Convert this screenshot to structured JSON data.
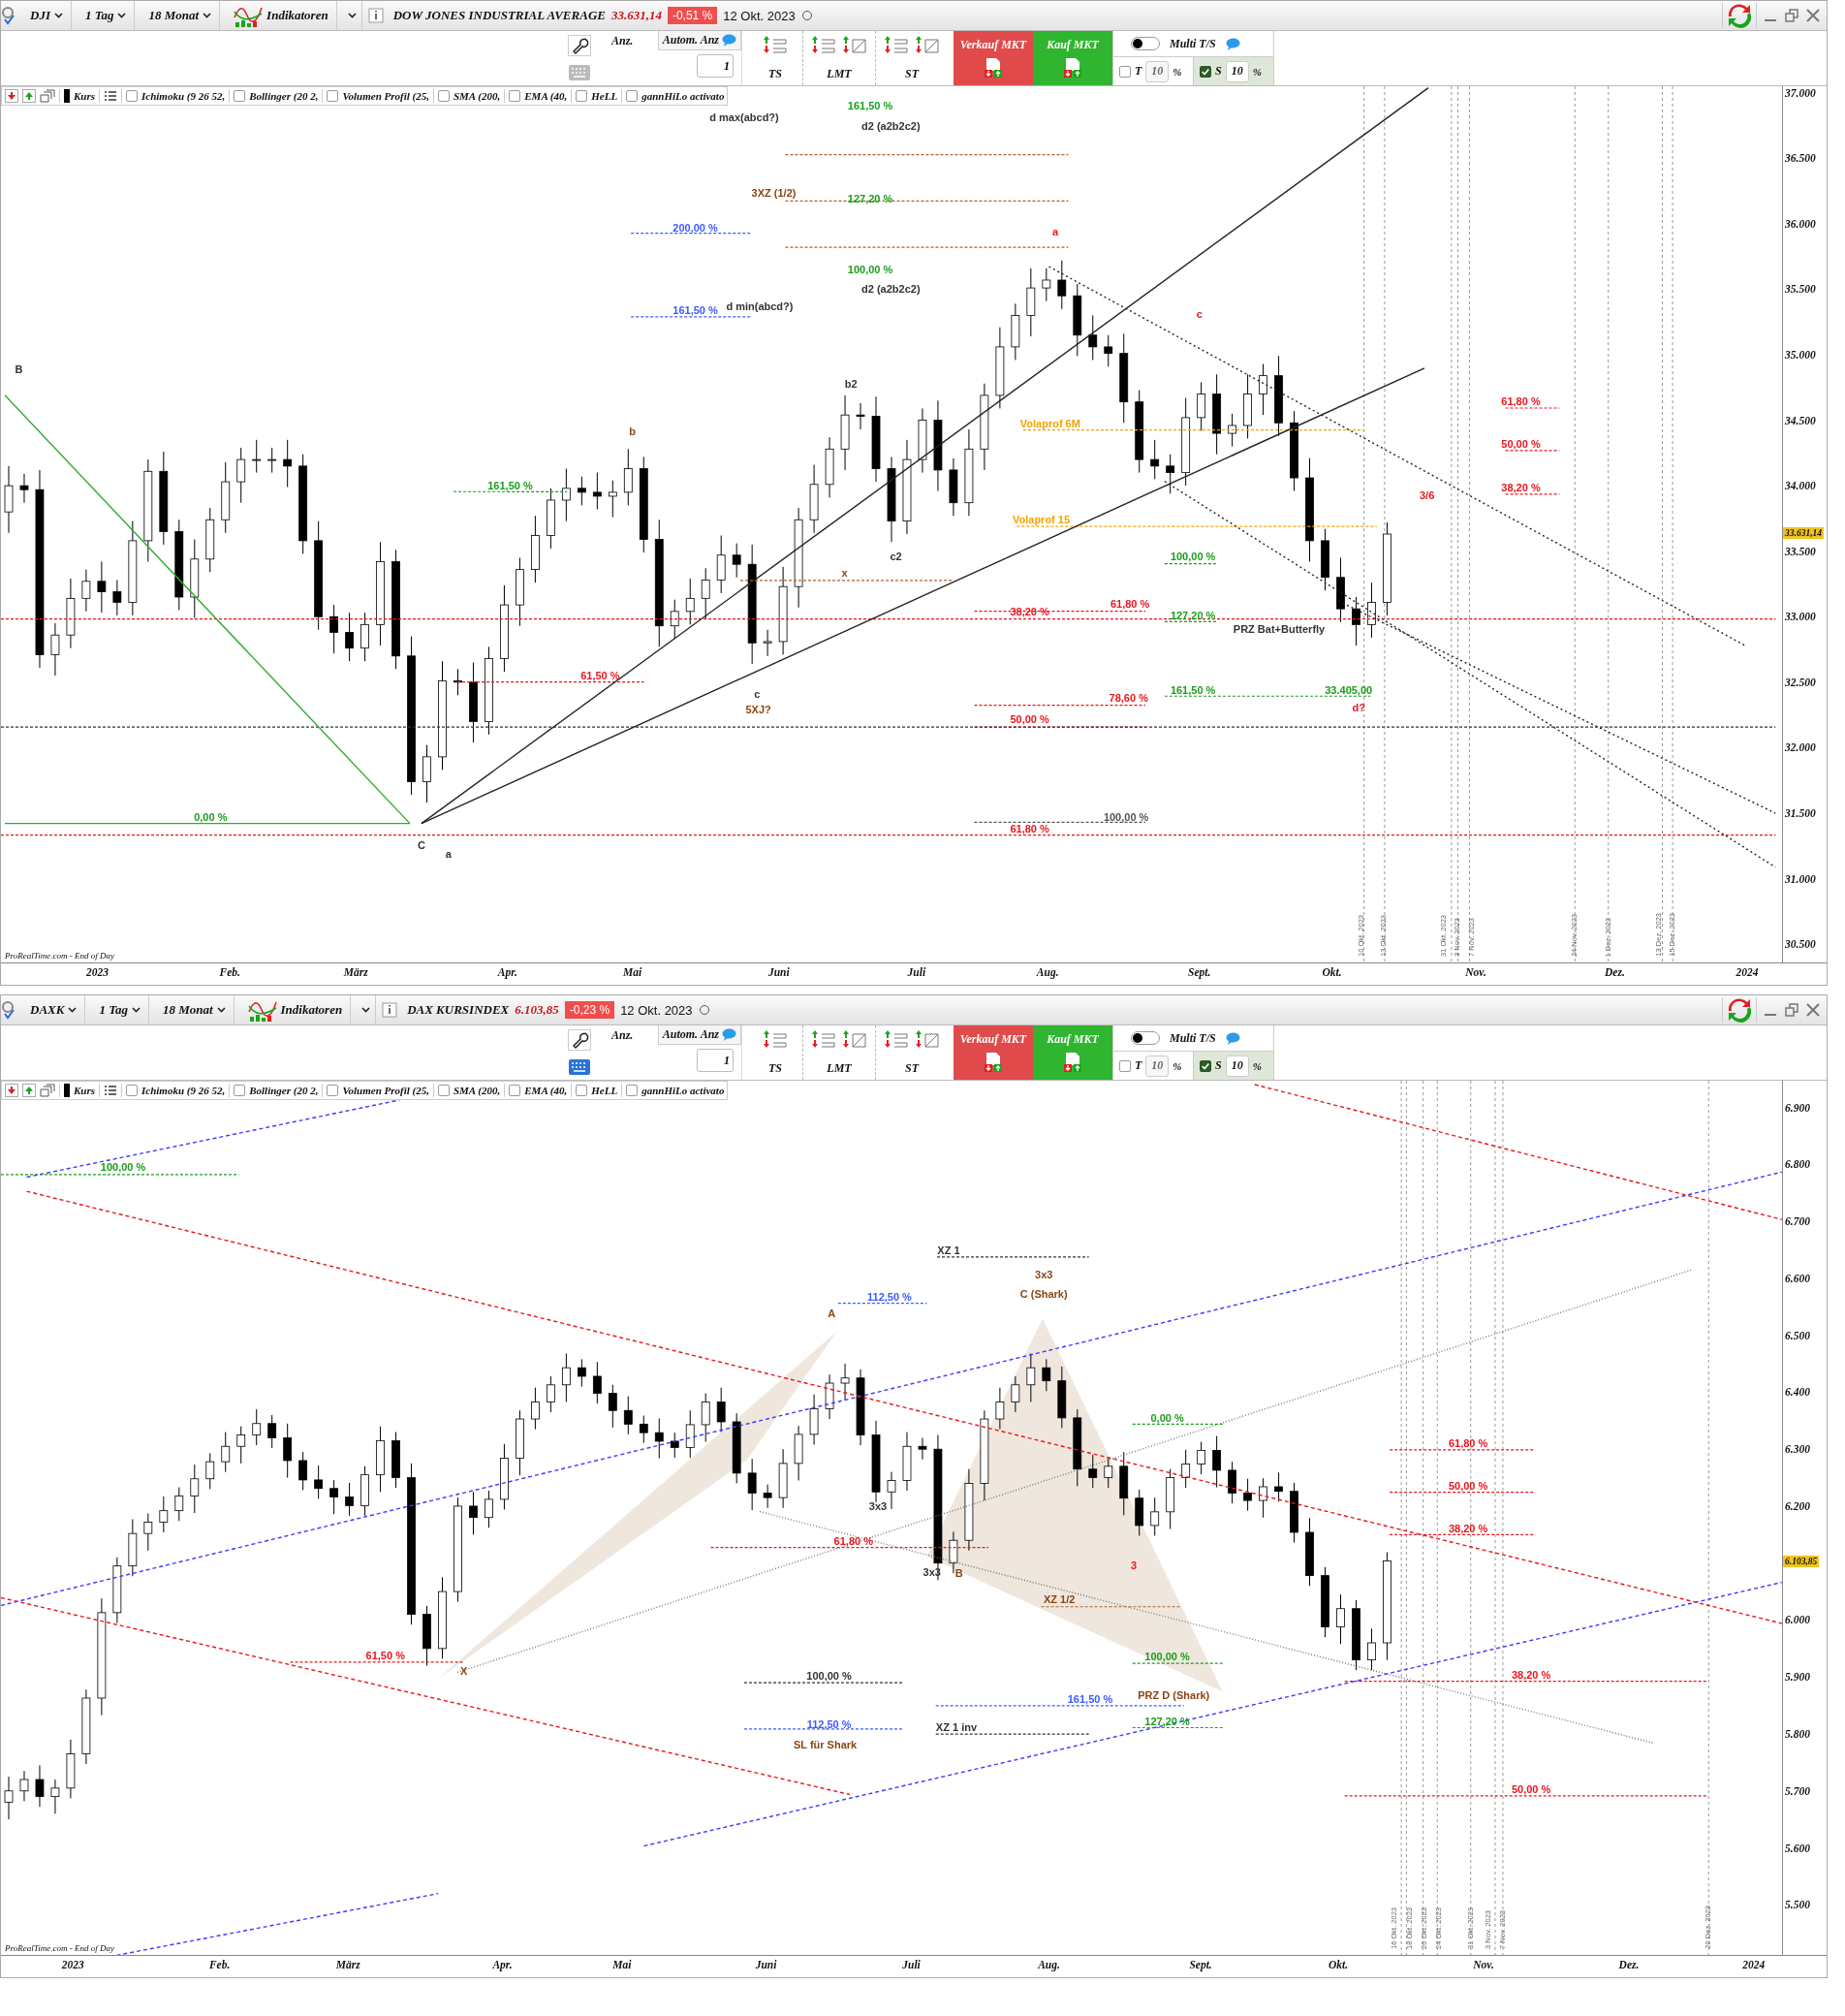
{
  "panels": [
    {
      "header": {
        "symbol": "DJI",
        "interval": "1 Tag",
        "range": "18 Monat",
        "indicators_label": "Indikatoren",
        "title": "DOW JONES INDUSTRIAL AVERAGE",
        "price": "33.631,14",
        "change": "-0,51 %",
        "date": "12 Okt. 2023"
      },
      "toolbar": {
        "keyboard_active": false,
        "count_label": "Anz.",
        "auto_tab": "Autom. Anz",
        "count_value": "1",
        "order_types": [
          "TS",
          "LMT",
          "ST"
        ],
        "sell_button": "Verkauf MKT",
        "buy_button": "Kauf MKT",
        "multi_ts": {
          "label": "Multi T/S",
          "on": false
        },
        "target": {
          "label": "T",
          "checked": false,
          "value": "10",
          "unit": "%"
        },
        "stop": {
          "label": "S",
          "checked": true,
          "value": "10",
          "unit": "%"
        }
      },
      "series_label": "Kurs",
      "indicators": [
        {
          "label": "Ichimoku (9 26 52,",
          "checked": false
        },
        {
          "label": "Bollinger (20 2,",
          "checked": false
        },
        {
          "label": "Volumen Profil (25,",
          "checked": false
        },
        {
          "label": "SMA (200,",
          "checked": false
        },
        {
          "label": "EMA (40,",
          "checked": false
        },
        {
          "label": "HeLL",
          "checked": false
        },
        {
          "label": "gannHiLo activato",
          "checked": false
        }
      ],
      "chart": {
        "price_tag": "33.631,14",
        "x_labels": [
          "2023",
          "Feb.",
          "März",
          "Apr.",
          "Mai",
          "Juni",
          "Juli",
          "Aug.",
          "Sept.",
          "Okt.",
          "Nov.",
          "Dez.",
          "2024"
        ],
        "date_markers": [
          "10 Okt. 2023",
          "13 Okt. 2023",
          "31 Okt. 2023",
          "3 Nov. 2023",
          "7 Nov. 2023",
          "24 Nov. 2023",
          "1 Dez. 2023",
          "13 Dez. 2023",
          "15 Dez. 2023"
        ],
        "source": "ProRealTime.com - End of Day",
        "chart_data": {
          "type": "candlestick",
          "categories": [
            null,
            null,
            null,
            null,
            null,
            null,
            null,
            null,
            null,
            null,
            null,
            null,
            null,
            null,
            null,
            null,
            null,
            null,
            null,
            null,
            null,
            null,
            null,
            null,
            null,
            null,
            null,
            null,
            null,
            null,
            null,
            null,
            null,
            null,
            null,
            null,
            null,
            null,
            null,
            null,
            null,
            null,
            null,
            null,
            null,
            null,
            null,
            null,
            null,
            null,
            null,
            null,
            null,
            null,
            null,
            null,
            null,
            null,
            null,
            null,
            null,
            null,
            null,
            null,
            null,
            null,
            null,
            null,
            null,
            null,
            null,
            null,
            null,
            null,
            null,
            null,
            null,
            null,
            null,
            null,
            null,
            null,
            null,
            null,
            null,
            null,
            null,
            null,
            null,
            null,
            null,
            null,
            null,
            null,
            null,
            null,
            null,
            null,
            null,
            null,
            null,
            null,
            null,
            null,
            null,
            null,
            null,
            null,
            null,
            null,
            null,
            null,
            null,
            null,
            null
          ],
          "ylim": [
            30360,
            37050
          ],
          "grid": true,
          "yticks": [
            {
              "value": 37000,
              "label": "37.000"
            },
            {
              "value": 36500,
              "label": "36.500"
            },
            {
              "value": 36000,
              "label": "36.000"
            },
            {
              "value": 35500,
              "label": "35.500"
            },
            {
              "value": 35000,
              "label": "35.000"
            },
            {
              "value": 34500,
              "label": "34.500"
            },
            {
              "value": 34000,
              "label": "34.000"
            },
            {
              "value": 33500,
              "label": "33.500"
            },
            {
              "value": 33000,
              "label": "33.000"
            },
            {
              "value": 32500,
              "label": "32.500"
            },
            {
              "value": 32000,
              "label": "32.000"
            },
            {
              "value": 31500,
              "label": "31.500"
            },
            {
              "value": 31000,
              "label": "31.000"
            },
            {
              "value": 30500,
              "label": "30.500"
            }
          ],
          "ohlc": [
            [
              33800,
              34150,
              33640,
              34000
            ],
            [
              34000,
              34090,
              33870,
              33970
            ],
            [
              33970,
              34120,
              32610,
              32710
            ],
            [
              32710,
              32950,
              32550,
              32860
            ],
            [
              32860,
              33290,
              32760,
              33140
            ],
            [
              33140,
              33360,
              33040,
              33270
            ],
            [
              33270,
              33420,
              33030,
              33190
            ],
            [
              33190,
              33280,
              33010,
              33110
            ],
            [
              33110,
              33730,
              33010,
              33580
            ],
            [
              33580,
              34200,
              33420,
              34110
            ],
            [
              34110,
              34260,
              33550,
              33650
            ],
            [
              33650,
              33740,
              33050,
              33150
            ],
            [
              33150,
              33590,
              32990,
              33440
            ],
            [
              33440,
              33830,
              33340,
              33740
            ],
            [
              33740,
              34180,
              33640,
              34030
            ],
            [
              34030,
              34290,
              33870,
              34200
            ],
            [
              34200,
              34350,
              34100,
              34200
            ],
            [
              34200,
              34290,
              34100,
              34200
            ],
            [
              34200,
              34350,
              33990,
              34150
            ],
            [
              34150,
              34240,
              33480,
              33580
            ],
            [
              33580,
              33730,
              32900,
              33000
            ],
            [
              33000,
              33090,
              32720,
              32880
            ],
            [
              32880,
              33030,
              32660,
              32760
            ],
            [
              32760,
              33030,
              32660,
              32940
            ],
            [
              32940,
              33570,
              32780,
              33420
            ],
            [
              33420,
              33510,
              32600,
              32700
            ],
            [
              32700,
              32850,
              31640,
              31740
            ],
            [
              31740,
              32020,
              31580,
              31930
            ],
            [
              31930,
              32660,
              31830,
              32510
            ],
            [
              32510,
              32600,
              32400,
              32500
            ],
            [
              32500,
              32650,
              32040,
              32200
            ],
            [
              32200,
              32770,
              32100,
              32680
            ],
            [
              32680,
              33240,
              32580,
              33090
            ],
            [
              33090,
              33450,
              32930,
              33360
            ],
            [
              33360,
              33770,
              33260,
              33620
            ],
            [
              33620,
              33980,
              33520,
              33890
            ],
            [
              33890,
              34130,
              33730,
              33980
            ],
            [
              33980,
              34070,
              33850,
              33950
            ],
            [
              33950,
              34100,
              33820,
              33920
            ],
            [
              33920,
              34040,
              33760,
              33950
            ],
            [
              33950,
              34280,
              33850,
              34130
            ],
            [
              34130,
              34220,
              33490,
              33590
            ],
            [
              33590,
              33740,
              32770,
              32930
            ],
            [
              32930,
              33130,
              32830,
              33040
            ],
            [
              33040,
              33290,
              32940,
              33140
            ],
            [
              33140,
              33370,
              32980,
              33280
            ],
            [
              33280,
              33620,
              33180,
              33470
            ],
            [
              33470,
              33560,
              33300,
              33400
            ],
            [
              33400,
              33550,
              32640,
              32800
            ],
            [
              32800,
              32900,
              32700,
              32810
            ],
            [
              32810,
              33380,
              32710,
              33230
            ],
            [
              33230,
              33830,
              33070,
              33740
            ],
            [
              33740,
              34160,
              33640,
              34010
            ],
            [
              34010,
              34370,
              33910,
              34280
            ],
            [
              34280,
              34690,
              34120,
              34540
            ],
            [
              34540,
              34630,
              34430,
              34530
            ],
            [
              34530,
              34680,
              34030,
              34130
            ],
            [
              34130,
              34220,
              33570,
              33730
            ],
            [
              33730,
              34350,
              33630,
              34200
            ],
            [
              34200,
              34590,
              34100,
              34500
            ],
            [
              34500,
              34650,
              33960,
              34120
            ],
            [
              34120,
              34210,
              33770,
              33870
            ],
            [
              33870,
              34430,
              33770,
              34280
            ],
            [
              34280,
              34780,
              34120,
              34690
            ],
            [
              34690,
              35210,
              34590,
              35060
            ],
            [
              35060,
              35390,
              34960,
              35300
            ],
            [
              35300,
              35660,
              35140,
              35510
            ],
            [
              35510,
              35660,
              35410,
              35570
            ],
            [
              35570,
              35720,
              35350,
              35450
            ],
            [
              35450,
              35540,
              34990,
              35150
            ],
            [
              35150,
              35300,
              34960,
              35060
            ],
            [
              35060,
              35150,
              34910,
              35010
            ],
            [
              35010,
              35160,
              34480,
              34640
            ],
            [
              34640,
              34730,
              34100,
              34200
            ],
            [
              34200,
              34350,
              34050,
              34150
            ],
            [
              34150,
              34240,
              33940,
              34100
            ],
            [
              34100,
              34670,
              34000,
              34520
            ],
            [
              34520,
              34790,
              34420,
              34700
            ],
            [
              34700,
              34850,
              34240,
              34400
            ],
            [
              34400,
              34550,
              34300,
              34460
            ],
            [
              34460,
              34850,
              34360,
              34700
            ],
            [
              34700,
              34930,
              34540,
              34840
            ],
            [
              34840,
              34990,
              34380,
              34480
            ],
            [
              34480,
              34570,
              33960,
              34060
            ],
            [
              34060,
              34210,
              33420,
              33580
            ],
            [
              33580,
              33670,
              33200,
              33300
            ],
            [
              33300,
              33450,
              32960,
              33060
            ],
            [
              33060,
              33150,
              32780,
              32940
            ],
            [
              32940,
              33260,
              32840,
              33110
            ],
            [
              33110,
              33720,
              33010,
              33631
            ],
            null,
            null,
            null,
            null,
            null,
            null,
            null,
            null,
            null,
            null,
            null,
            null,
            null,
            null,
            null,
            null,
            null,
            null,
            null,
            null,
            null,
            null,
            null,
            null,
            null
          ]
        },
        "annotations": [
          {
            "text": "161,50 %",
            "color": "#1a9e1a"
          },
          {
            "text": "d max(abcd?)",
            "color": "#333333"
          },
          {
            "text": "d2 (a2b2c2)",
            "color": "#333333"
          },
          {
            "text": "3XZ (1/2)",
            "color": "#8b4513"
          },
          {
            "text": "127,20 %",
            "color": "#1a9e1a"
          },
          {
            "text": "200,00 %",
            "color": "#3b5bff"
          },
          {
            "text": "a",
            "color": "#e8161c"
          },
          {
            "text": "100,00 %",
            "color": "#1a9e1a"
          },
          {
            "text": "d2 (a2b2c2)",
            "color": "#333333"
          },
          {
            "text": "161,50 %",
            "color": "#3b5bff"
          },
          {
            "text": "d min(abcd?)",
            "color": "#333333"
          },
          {
            "text": "c",
            "color": "#e8161c"
          },
          {
            "text": "B",
            "color": "#333333"
          },
          {
            "text": "b2",
            "color": "#333333"
          },
          {
            "text": "61,80 %",
            "color": "#e8161c"
          },
          {
            "text": "b",
            "color": "#8b4513"
          },
          {
            "text": "Volaprof 6M",
            "color": "#f5a300"
          },
          {
            "text": "50,00 %",
            "color": "#e8161c"
          },
          {
            "text": "161,50 %",
            "color": "#1a9e1a"
          },
          {
            "text": "38,20 %",
            "color": "#e8161c"
          },
          {
            "text": "3/6",
            "color": "#e8161c"
          },
          {
            "text": "Volaprof 15",
            "color": "#f5a300"
          },
          {
            "text": "c2",
            "color": "#333333"
          },
          {
            "text": "100,00 %",
            "color": "#1a9e1a"
          },
          {
            "text": "x",
            "color": "#8b4513"
          },
          {
            "text": "38,20 %",
            "color": "#e8161c"
          },
          {
            "text": "61,80 %",
            "color": "#e8161c"
          },
          {
            "text": "127,20 %",
            "color": "#1a9e1a"
          },
          {
            "text": "PRZ Bat+Butterfly",
            "color": "#333333"
          },
          {
            "text": "61,50 %",
            "color": "#e8161c"
          },
          {
            "text": "c",
            "color": "#333333"
          },
          {
            "text": "78,60 %",
            "color": "#e8161c"
          },
          {
            "text": "161,50 %",
            "color": "#1a9e1a"
          },
          {
            "text": "33.405,00",
            "color": "#1a9e1a"
          },
          {
            "text": "5XJ?",
            "color": "#8b4513"
          },
          {
            "text": "d?",
            "color": "#e8161c"
          },
          {
            "text": "50,00 %",
            "color": "#e8161c"
          },
          {
            "text": "0,00 %",
            "color": "#1a9e1a"
          },
          {
            "text": "100,00 %",
            "color": "#555555"
          },
          {
            "text": "61,80 %",
            "color": "#e8161c"
          },
          {
            "text": "C",
            "color": "#333333"
          },
          {
            "text": "a",
            "color": "#333333"
          }
        ]
      }
    },
    {
      "header": {
        "symbol": "DAXK",
        "interval": "1 Tag",
        "range": "18 Monat",
        "indicators_label": "Indikatoren",
        "title": "DAX KURSINDEX",
        "price": "6.103,85",
        "change": "-0,23 %",
        "date": "12 Okt. 2023"
      },
      "toolbar": {
        "keyboard_active": true,
        "count_label": "Anz.",
        "auto_tab": "Autom. Anz",
        "count_value": "1",
        "order_types": [
          "TS",
          "LMT",
          "ST"
        ],
        "sell_button": "Verkauf MKT",
        "buy_button": "Kauf MKT",
        "multi_ts": {
          "label": "Multi T/S",
          "on": false
        },
        "target": {
          "label": "T",
          "checked": false,
          "value": "10",
          "unit": "%"
        },
        "stop": {
          "label": "S",
          "checked": true,
          "value": "10",
          "unit": "%"
        }
      },
      "series_label": "Kurs",
      "indicators": [
        {
          "label": "Ichimoku (9 26 52,",
          "checked": false
        },
        {
          "label": "Bollinger (20 2,",
          "checked": false
        },
        {
          "label": "Volumen Profil (25,",
          "checked": false
        },
        {
          "label": "SMA (200,",
          "checked": false
        },
        {
          "label": "EMA (40,",
          "checked": false
        },
        {
          "label": "HeLL",
          "checked": false
        },
        {
          "label": "gannHiLo activato",
          "checked": false
        }
      ],
      "chart": {
        "price_tag": "6.103,85",
        "x_labels": [
          "2023",
          "Feb.",
          "März",
          "Apr.",
          "Mai",
          "Juni",
          "Juli",
          "Aug.",
          "Sept.",
          "Okt.",
          "Nov.",
          "Dez.",
          "2024"
        ],
        "date_markers": [
          "16 Okt. 2023",
          "18 Okt. 2023",
          "20 Okt. 2023",
          "24 Okt. 2023",
          "31 Okt. 2023",
          "3 Nov. 2023",
          "7 Nov. 2023",
          "20 Dez. 2023"
        ],
        "source": "ProRealTime.com - End of Day",
        "chart_data": {
          "type": "candlestick",
          "categories": [
            null,
            null,
            null,
            null,
            null,
            null,
            null,
            null,
            null,
            null,
            null,
            null,
            null,
            null,
            null,
            null,
            null,
            null,
            null,
            null,
            null,
            null,
            null,
            null,
            null,
            null,
            null,
            null,
            null,
            null,
            null,
            null,
            null,
            null,
            null,
            null,
            null,
            null,
            null,
            null,
            null,
            null,
            null,
            null,
            null,
            null,
            null,
            null,
            null,
            null,
            null,
            null,
            null,
            null,
            null,
            null,
            null,
            null,
            null,
            null,
            null,
            null,
            null,
            null,
            null,
            null,
            null,
            null,
            null,
            null,
            null,
            null,
            null,
            null,
            null,
            null,
            null,
            null,
            null,
            null,
            null,
            null,
            null,
            null,
            null,
            null,
            null,
            null,
            null,
            null,
            null,
            null,
            null,
            null,
            null,
            null,
            null,
            null,
            null,
            null,
            null,
            null,
            null,
            null,
            null,
            null,
            null,
            null,
            null,
            null,
            null,
            null,
            null,
            null,
            null
          ],
          "ylim": [
            5412,
            6947
          ],
          "grid": true,
          "yticks": [
            {
              "value": 6900,
              "label": "6.900"
            },
            {
              "value": 6800,
              "label": "6.800"
            },
            {
              "value": 6700,
              "label": "6.700"
            },
            {
              "value": 6600,
              "label": "6.600"
            },
            {
              "value": 6500,
              "label": "6.500"
            },
            {
              "value": 6400,
              "label": "6.400"
            },
            {
              "value": 6300,
              "label": "6.300"
            },
            {
              "value": 6200,
              "label": "6.200"
            },
            {
              "value": 6000,
              "label": "6.000"
            },
            {
              "value": 5900,
              "label": "5.900"
            },
            {
              "value": 5800,
              "label": "5.800"
            },
            {
              "value": 5700,
              "label": "5.700"
            },
            {
              "value": 5600,
              "label": "5.600"
            },
            {
              "value": 5500,
              "label": "5.500"
            }
          ],
          "ohlc": [
            [
              5680,
              5725,
              5650,
              5700
            ],
            [
              5700,
              5735,
              5682,
              5720
            ],
            [
              5720,
              5745,
              5672,
              5690
            ],
            [
              5690,
              5720,
              5660,
              5705
            ],
            [
              5705,
              5790,
              5687,
              5765
            ],
            [
              5765,
              5878,
              5747,
              5863
            ],
            [
              5863,
              6038,
              5833,
              6013
            ],
            [
              6013,
              6110,
              5995,
              6095
            ],
            [
              6095,
              6177,
              6077,
              6152
            ],
            [
              6152,
              6187,
              6122,
              6172
            ],
            [
              6172,
              6217,
              6154,
              6192
            ],
            [
              6192,
              6233,
              6174,
              6218
            ],
            [
              6218,
              6273,
              6188,
              6248
            ],
            [
              6248,
              6293,
              6230,
              6278
            ],
            [
              6278,
              6330,
              6260,
              6305
            ],
            [
              6305,
              6340,
              6275,
              6325
            ],
            [
              6325,
              6370,
              6307,
              6345
            ],
            [
              6345,
              6360,
              6302,
              6320
            ],
            [
              6320,
              6345,
              6250,
              6280
            ],
            [
              6280,
              6295,
              6228,
              6246
            ],
            [
              6246,
              6271,
              6213,
              6231
            ],
            [
              6231,
              6246,
              6186,
              6216
            ],
            [
              6216,
              6241,
              6183,
              6201
            ],
            [
              6201,
              6270,
              6183,
              6255
            ],
            [
              6255,
              6340,
              6225,
              6315
            ],
            [
              6315,
              6330,
              6232,
              6250
            ],
            [
              6250,
              6275,
              5992,
              6010
            ],
            [
              6010,
              6025,
              5920,
              5950
            ],
            [
              5950,
              6075,
              5932,
              6050
            ],
            [
              6050,
              6215,
              6032,
              6200
            ],
            [
              6200,
              6225,
              6150,
              6180
            ],
            [
              6180,
              6227,
              6162,
              6212
            ],
            [
              6212,
              6309,
              6194,
              6284
            ],
            [
              6284,
              6368,
              6254,
              6353
            ],
            [
              6353,
              6408,
              6335,
              6383
            ],
            [
              6383,
              6428,
              6365,
              6413
            ],
            [
              6413,
              6468,
              6383,
              6443
            ],
            [
              6443,
              6458,
              6410,
              6428
            ],
            [
              6428,
              6453,
              6380,
              6398
            ],
            [
              6398,
              6413,
              6338,
              6368
            ],
            [
              6368,
              6393,
              6326,
              6344
            ],
            [
              6344,
              6359,
              6311,
              6329
            ],
            [
              6329,
              6354,
              6284,
              6314
            ],
            [
              6314,
              6329,
              6285,
              6303
            ],
            [
              6303,
              6368,
              6285,
              6343
            ],
            [
              6343,
              6398,
              6313,
              6383
            ],
            [
              6383,
              6408,
              6330,
              6348
            ],
            [
              6348,
              6363,
              6240,
              6258
            ],
            [
              6258,
              6283,
              6193,
              6223
            ],
            [
              6223,
              6238,
              6197,
              6215
            ],
            [
              6215,
              6300,
              6197,
              6275
            ],
            [
              6275,
              6341,
              6245,
              6326
            ],
            [
              6326,
              6396,
              6308,
              6371
            ],
            [
              6371,
              6431,
              6353,
              6416
            ],
            [
              6416,
              6450,
              6386,
              6425
            ],
            [
              6425,
              6440,
              6307,
              6325
            ],
            [
              6325,
              6350,
              6207,
              6225
            ],
            [
              6225,
              6260,
              6195,
              6245
            ],
            [
              6245,
              6330,
              6227,
              6305
            ],
            [
              6305,
              6320,
              6282,
              6300
            ],
            [
              6300,
              6325,
              6070,
              6100
            ],
            [
              6100,
              6155,
              6082,
              6140
            ],
            [
              6140,
              6265,
              6122,
              6240
            ],
            [
              6240,
              6368,
              6210,
              6353
            ],
            [
              6353,
              6408,
              6335,
              6383
            ],
            [
              6383,
              6428,
              6365,
              6413
            ],
            [
              6413,
              6468,
              6383,
              6443
            ],
            [
              6443,
              6458,
              6402,
              6420
            ],
            [
              6420,
              6445,
              6337,
              6355
            ],
            [
              6355,
              6370,
              6235,
              6265
            ],
            [
              6265,
              6290,
              6232,
              6250
            ],
            [
              6250,
              6285,
              6232,
              6270
            ],
            [
              6270,
              6295,
              6184,
              6214
            ],
            [
              6214,
              6229,
              6148,
              6166
            ],
            [
              6166,
              6215,
              6148,
              6190
            ],
            [
              6190,
              6265,
              6160,
              6250
            ],
            [
              6250,
              6299,
              6232,
              6274
            ],
            [
              6274,
              6313,
              6256,
              6298
            ],
            [
              6298,
              6323,
              6233,
              6263
            ],
            [
              6263,
              6278,
              6205,
              6223
            ],
            [
              6223,
              6248,
              6192,
              6210
            ],
            [
              6210,
              6249,
              6180,
              6234
            ],
            [
              6234,
              6259,
              6208,
              6226
            ],
            [
              6226,
              6241,
              6136,
              6154
            ],
            [
              6154,
              6179,
              6060,
              6078
            ],
            [
              6078,
              6093,
              5970,
              5988
            ],
            [
              5988,
              6045,
              5958,
              6020
            ],
            [
              6020,
              6035,
              5912,
              5930
            ],
            [
              5930,
              5985,
              5912,
              5960
            ],
            [
              5960,
              6119,
              5930,
              6104
            ],
            null,
            null,
            null,
            null,
            null,
            null,
            null,
            null,
            null,
            null,
            null,
            null,
            null,
            null,
            null,
            null,
            null,
            null,
            null,
            null,
            null,
            null,
            null,
            null,
            null
          ]
        },
        "annotations": [
          {
            "text": "100,00 %",
            "color": "#1a9e1a"
          },
          {
            "text": "XZ 1",
            "color": "#333333"
          },
          {
            "text": "3x3",
            "color": "#8b4513"
          },
          {
            "text": "112,50 %",
            "color": "#3b5bff"
          },
          {
            "text": "C (Shark)",
            "color": "#8b4513"
          },
          {
            "text": "A",
            "color": "#8b4513"
          },
          {
            "text": "0,00 %",
            "color": "#1a9e1a"
          },
          {
            "text": "61,80 %",
            "color": "#e8161c"
          },
          {
            "text": "50,00 %",
            "color": "#e8161c"
          },
          {
            "text": "3x3",
            "color": "#333333"
          },
          {
            "text": "38,20 %",
            "color": "#e8161c"
          },
          {
            "text": "61,80 %",
            "color": "#e8161c"
          },
          {
            "text": "3x3",
            "color": "#333333"
          },
          {
            "text": "B",
            "color": "#8b4513"
          },
          {
            "text": "3",
            "color": "#e8161c"
          },
          {
            "text": "XZ 1/2",
            "color": "#8b4513"
          },
          {
            "text": "61,50 %",
            "color": "#e8161c"
          },
          {
            "text": "100,00 %",
            "color": "#1a9e1a"
          },
          {
            "text": "X",
            "color": "#8b4513"
          },
          {
            "text": "100,00 %",
            "color": "#333333"
          },
          {
            "text": "38,20 %",
            "color": "#e8161c"
          },
          {
            "text": "161,50 %",
            "color": "#3b5bff"
          },
          {
            "text": "PRZ D (Shark)",
            "color": "#8b4513"
          },
          {
            "text": "112,50 %",
            "color": "#3b5bff"
          },
          {
            "text": "XZ 1 inv",
            "color": "#333333"
          },
          {
            "text": "127,20 %",
            "color": "#1a9e1a"
          },
          {
            "text": "SL für Shark",
            "color": "#8b4513"
          },
          {
            "text": "50,00 %",
            "color": "#e8161c"
          }
        ]
      }
    }
  ]
}
